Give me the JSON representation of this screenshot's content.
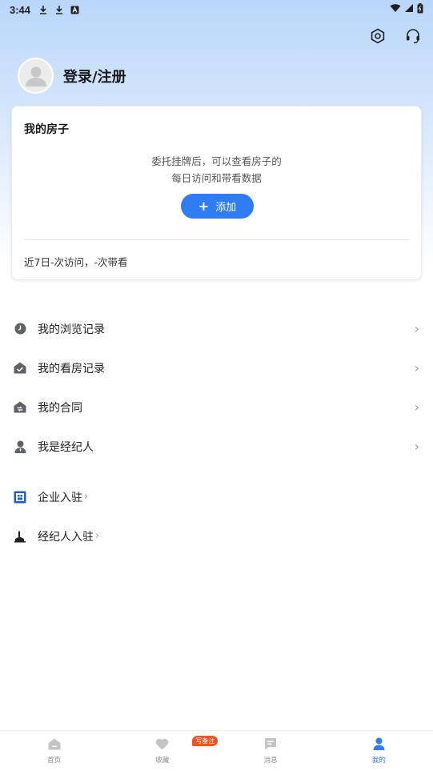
{
  "status_bar": {
    "time": "3:44",
    "icons": [
      "download-icon",
      "download-icon",
      "a-icon",
      "wifi-icon",
      "signal-icon",
      "battery-icon"
    ]
  },
  "header": {
    "actions": [
      "settings-icon",
      "headset-icon"
    ]
  },
  "profile": {
    "login_label": "登录/注册"
  },
  "house_card": {
    "title": "我的房子",
    "desc_line1": "委托挂牌后，可以查看房子的",
    "desc_line2": "每日访问和带看数据",
    "add_label": "添加",
    "stats": "近7日-次访问，-次带看"
  },
  "menu": {
    "items": [
      {
        "label": "我的浏览记录",
        "icon": "clock-icon"
      },
      {
        "label": "我的看房记录",
        "icon": "house-check-icon"
      },
      {
        "label": "我的合同",
        "icon": "contract-icon"
      },
      {
        "label": "我是经纪人",
        "icon": "person-icon"
      }
    ]
  },
  "secondary_menu": {
    "items": [
      {
        "label": "企业入驻",
        "icon": "enterprise-icon"
      },
      {
        "label": "经纪人入驻",
        "icon": "agent-icon"
      }
    ]
  },
  "tabbar": {
    "tabs": [
      {
        "label": "首页",
        "icon": "home-icon"
      },
      {
        "label": "收藏",
        "icon": "heart-icon"
      },
      {
        "label": "消息",
        "icon": "message-icon"
      },
      {
        "label": "我的",
        "icon": "user-icon"
      }
    ],
    "badge": "写备注",
    "active_index": 3
  },
  "colors": {
    "accent": "#2f7cf6",
    "badge": "#f4511e",
    "icon_gray": "#5f6368"
  }
}
